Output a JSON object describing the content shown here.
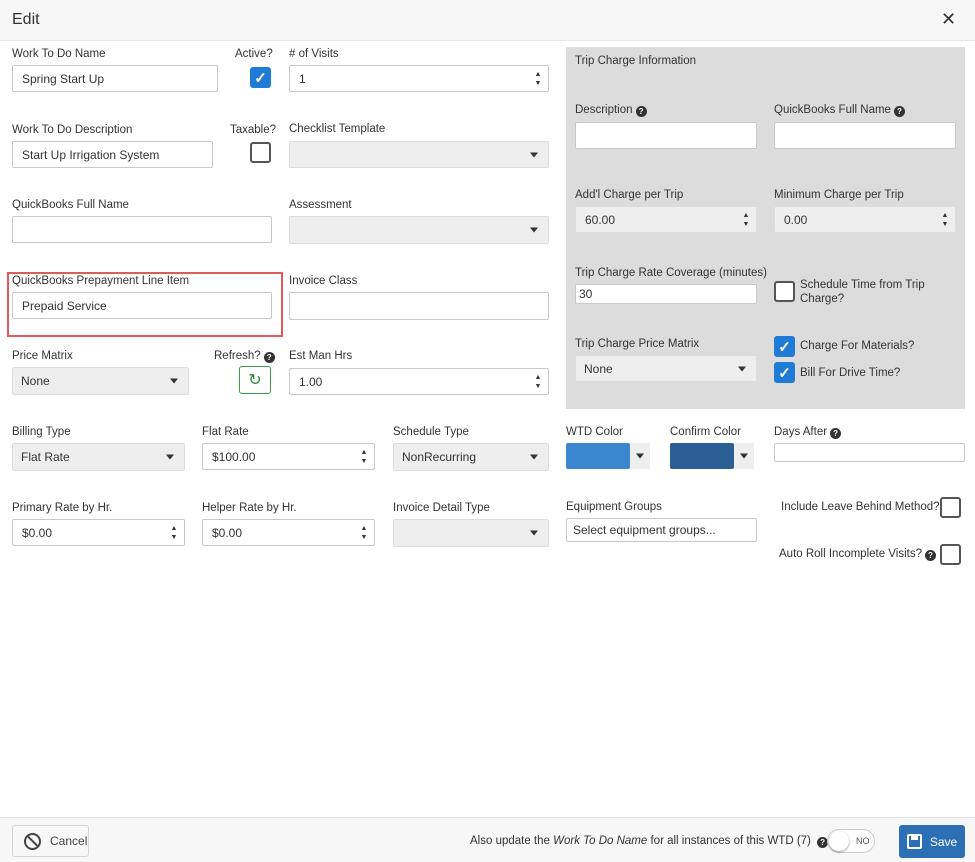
{
  "window": {
    "title": "Edit"
  },
  "left": {
    "wtd_name": {
      "label": "Work To Do Name",
      "value": "Spring Start Up"
    },
    "active": {
      "label": "Active?",
      "checked": true
    },
    "visits": {
      "label": "# of Visits",
      "value": "1"
    },
    "wtd_description": {
      "label": "Work To Do Description",
      "value": "Start Up Irrigation System"
    },
    "taxable": {
      "label": "Taxable?",
      "checked": false
    },
    "checklist": {
      "label": "Checklist Template",
      "value": ""
    },
    "qb_full_name": {
      "label": "QuickBooks Full Name",
      "value": ""
    },
    "assessment": {
      "label": "Assessment",
      "value": ""
    },
    "qb_prepayment": {
      "label": "QuickBooks Prepayment Line Item",
      "value": "Prepaid Service"
    },
    "invoice_class": {
      "label": "Invoice Class",
      "value": ""
    },
    "price_matrix": {
      "label": "Price Matrix",
      "value": "None"
    },
    "refresh": {
      "label": "Refresh?"
    },
    "est_man_hrs": {
      "label": "Est Man Hrs",
      "value": "1.00"
    },
    "billing_type": {
      "label": "Billing Type",
      "value": "Flat Rate"
    },
    "flat_rate": {
      "label": "Flat Rate",
      "value": "$100.00"
    },
    "schedule_type": {
      "label": "Schedule Type",
      "value": "NonRecurring"
    },
    "primary_rate": {
      "label": "Primary Rate by Hr.",
      "value": "$0.00"
    },
    "helper_rate": {
      "label": "Helper Rate by Hr.",
      "value": "$0.00"
    },
    "invoice_detail": {
      "label": "Invoice Detail Type",
      "value": ""
    }
  },
  "trip": {
    "title": "Trip Charge Information",
    "description": {
      "label": "Description",
      "value": ""
    },
    "qb_full_name": {
      "label": "QuickBooks Full Name",
      "value": ""
    },
    "addl_charge": {
      "label": "Add'l Charge per Trip",
      "value": "60.00"
    },
    "min_charge": {
      "label": "Minimum Charge per Trip",
      "value": "0.00"
    },
    "rate_coverage": {
      "label": "Trip Charge Rate Coverage (minutes)",
      "value": "30"
    },
    "schedule_time": {
      "label_1": "Schedule Time from Trip",
      "label_2": "Charge?",
      "checked": false
    },
    "price_matrix": {
      "label": "Trip Charge Price Matrix",
      "value": "None"
    },
    "charge_materials": {
      "label": "Charge For Materials?",
      "checked": true
    },
    "bill_drive": {
      "label": "Bill For Drive Time?",
      "checked": true
    }
  },
  "right": {
    "wtd_color": {
      "label": "WTD Color",
      "color": "#3c88d0"
    },
    "confirm_color": {
      "label": "Confirm Color",
      "color": "#2b5f93"
    },
    "days_after": {
      "label": "Days After",
      "value": ""
    },
    "equipment_groups": {
      "label": "Equipment Groups",
      "placeholder": "Select equipment groups..."
    },
    "leave_behind": {
      "label": "Include Leave Behind Method?",
      "checked": false
    },
    "auto_roll": {
      "label": "Auto Roll Incomplete Visits?",
      "checked": false
    }
  },
  "footer": {
    "cancel_label": "Cancel",
    "update_text_pre": "Also update the",
    "update_text_em": "Work To Do Name",
    "update_text_post": "for all instances of this WTD (7)",
    "toggle_label": "NO",
    "save_label": "Save"
  },
  "icons": {
    "close": "close-icon",
    "help": "question-circle-icon",
    "refresh": "refresh-icon",
    "cancel": "ban-icon",
    "save": "floppy-disk-icon"
  }
}
